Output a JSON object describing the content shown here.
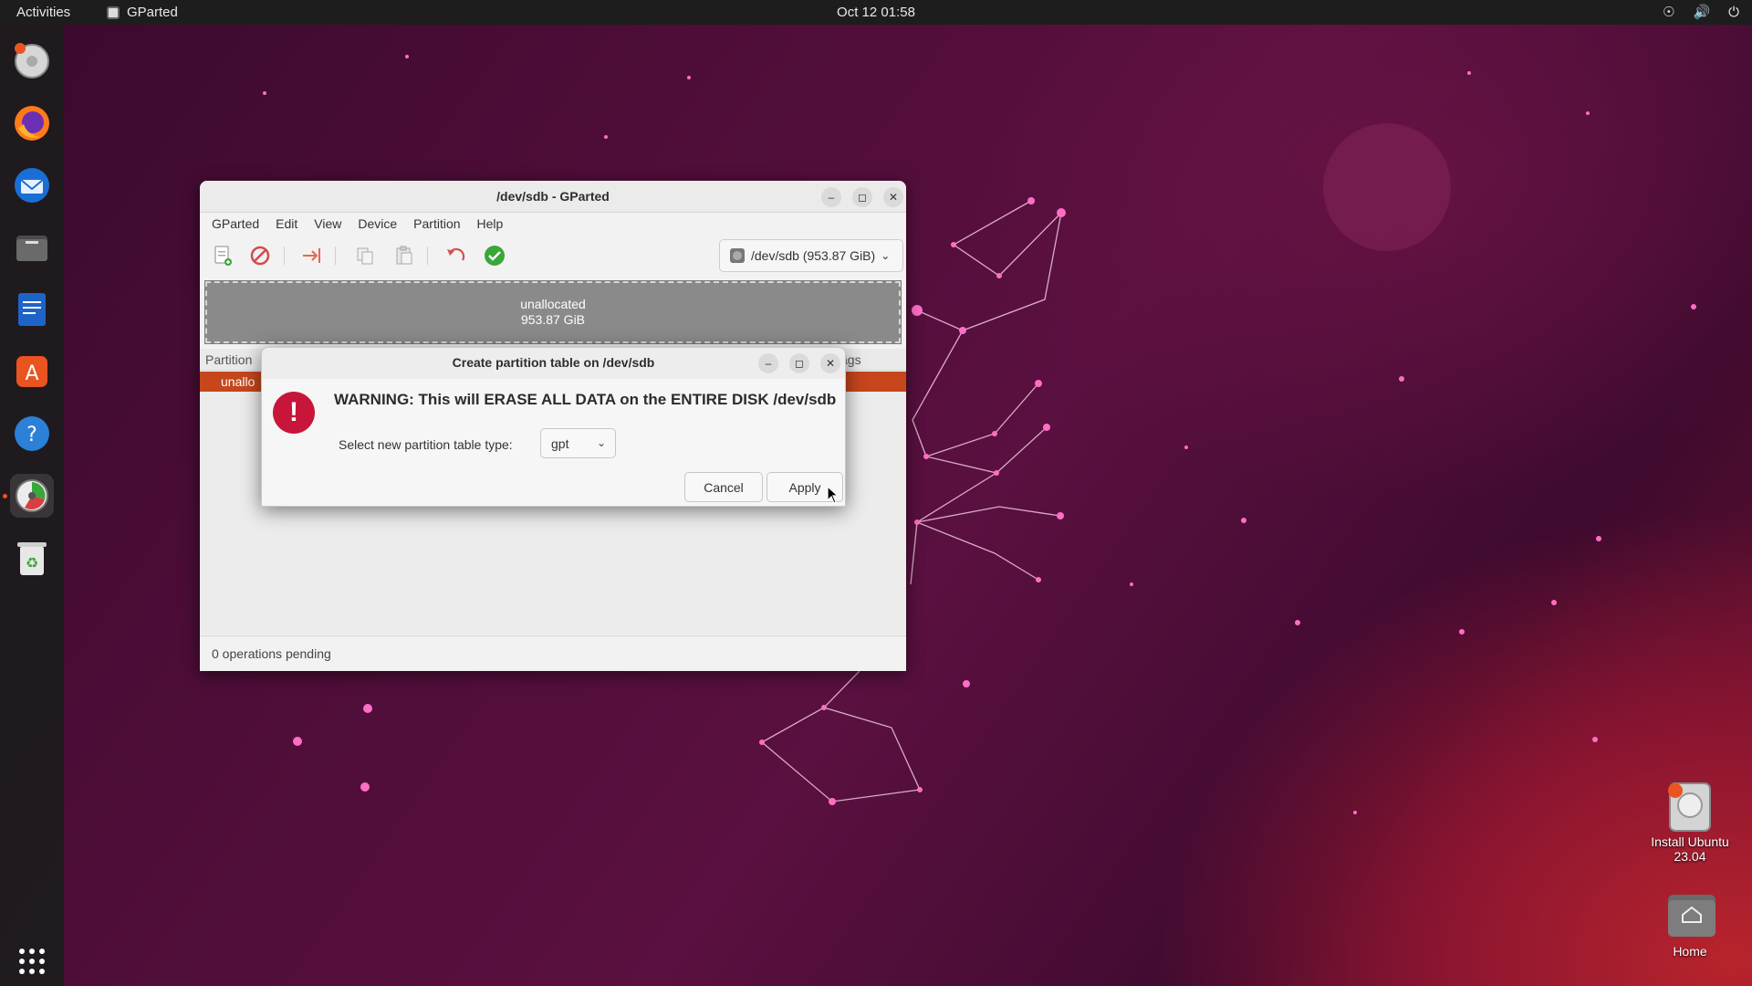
{
  "topbar": {
    "activities": "Activities",
    "app_name": "GParted",
    "clock": "Oct 12  01:58",
    "tray_icons": [
      "accessibility-icon",
      "volume-icon",
      "power-icon"
    ]
  },
  "dock": {
    "items": [
      {
        "name": "ubuntu-installer-icon"
      },
      {
        "name": "firefox-icon"
      },
      {
        "name": "thunderbird-icon"
      },
      {
        "name": "files-icon"
      },
      {
        "name": "libreoffice-writer-icon"
      },
      {
        "name": "app-center-icon"
      },
      {
        "name": "help-icon"
      },
      {
        "name": "gparted-icon",
        "active": true
      },
      {
        "name": "trash-icon"
      }
    ],
    "grid": "show-apps-icon"
  },
  "desktop": {
    "install": {
      "line1": "Install Ubuntu",
      "line2": "23.04"
    },
    "home": {
      "label": "Home"
    }
  },
  "gparted": {
    "title": "/dev/sdb - GParted",
    "menu": [
      "GParted",
      "Edit",
      "View",
      "Device",
      "Partition",
      "Help"
    ],
    "device": "/dev/sdb (953.87 GiB)",
    "disk_graphic": {
      "label": "unallocated",
      "size": "953.87 GiB"
    },
    "partition_header_left": "Partition",
    "partition_header_right": "ags",
    "partition_row": "unallo",
    "status": "0 operations pending"
  },
  "dialog": {
    "title": "Create partition table on /dev/sdb",
    "warning": "WARNING:  This will ERASE ALL DATA on the ENTIRE DISK /dev/sdb",
    "type_label": "Select new partition table type:",
    "type_value": "gpt",
    "cancel": "Cancel",
    "apply": "Apply"
  },
  "colors": {
    "accent": "#e95420",
    "warning": "#c7163a",
    "selected_row": "#c7461c"
  }
}
